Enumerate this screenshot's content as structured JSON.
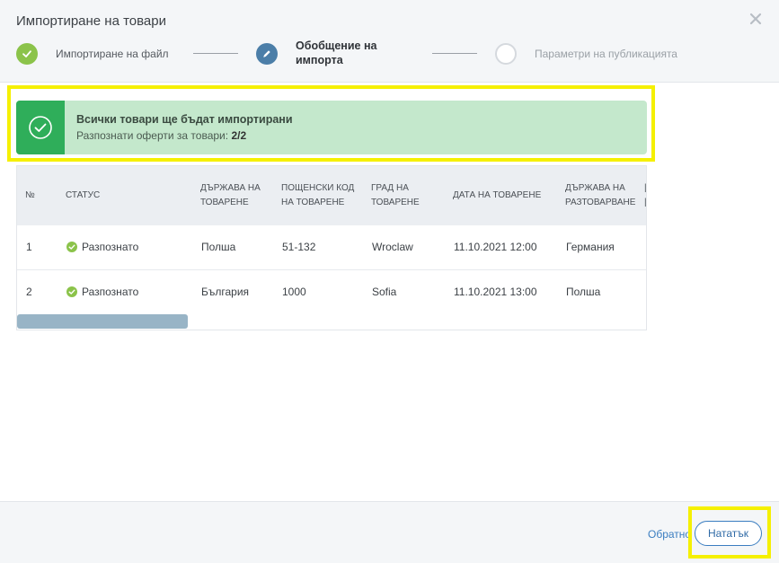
{
  "header": {
    "title": "Импортиране на товари",
    "steps": [
      {
        "label": "Импортиране на файл",
        "state": "done",
        "icon": "check-icon"
      },
      {
        "label_line1": "Обобщение на",
        "label_line2": "импорта",
        "state": "active",
        "icon": "pencil-icon"
      },
      {
        "label": "Параметри на публикацията",
        "state": "pending",
        "icon": "empty-circle-icon"
      }
    ]
  },
  "banner": {
    "title": "Всички товари ще бъдат импортирани",
    "subtitle": "Разпознати оферти за товари:",
    "count": "2/2",
    "color": "#2fae5a"
  },
  "table": {
    "headers": {
      "num": "№",
      "status": "СТАТУС",
      "load_country_1": "ДЪРЖАВА НА",
      "load_country_2": "ТОВАРЕНЕ",
      "postal_1": "ПОЩЕНСКИ КОД",
      "postal_2": "НА ТОВАРЕНЕ",
      "city_1": "ГРАД НА",
      "city_2": "ТОВАРЕНЕ",
      "date": "ДАТА НА ТОВАРЕНЕ",
      "unload_country_1": "ДЪРЖАВА НА",
      "unload_country_2": "РАЗТОВАРВАНЕ"
    },
    "rows": [
      {
        "num": "1",
        "status": "Разпознато",
        "load_country": "Полша",
        "postal": "51-132",
        "city": "Wroclaw",
        "date": "11.10.2021 12:00",
        "unload_country": "Германия"
      },
      {
        "num": "2",
        "status": "Разпознато",
        "load_country": "България",
        "postal": "1000",
        "city": "Sofia",
        "date": "11.10.2021 13:00",
        "unload_country": "Полша"
      }
    ]
  },
  "footer": {
    "back_label": "Обратно",
    "next_label": "Нататък"
  }
}
